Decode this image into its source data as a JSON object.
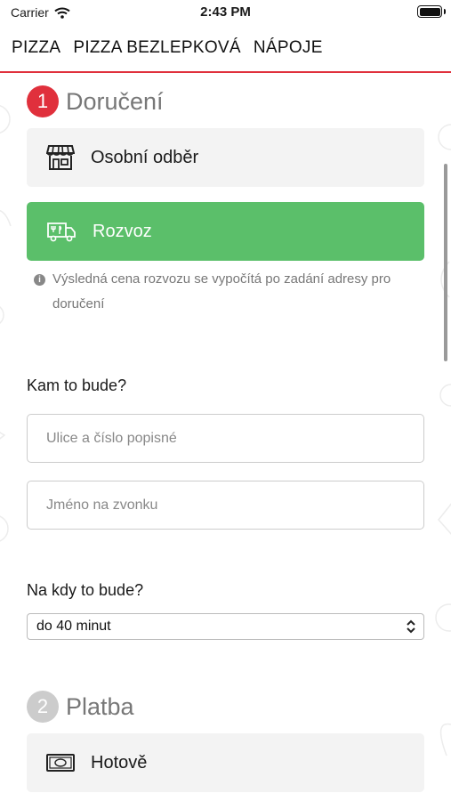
{
  "status_bar": {
    "carrier": "Carrier",
    "time": "2:43 PM"
  },
  "nav": {
    "items": [
      "PIZZA",
      "PIZZA BEZLEPKOVÁ",
      "NÁPOJE"
    ]
  },
  "delivery": {
    "step_number": "1",
    "title": "Doručení",
    "options": [
      {
        "label": "Osobní odběr",
        "icon": "store-icon",
        "selected": false
      },
      {
        "label": "Rozvoz",
        "icon": "delivery-van-icon",
        "selected": true
      }
    ],
    "info_text": "Výsledná cena rozvozu se vypočítá po zadání adresy pro doručení"
  },
  "address": {
    "label": "Kam to bude?",
    "street_placeholder": "Ulice a číslo popisné",
    "bell_placeholder": "Jméno na zvonku"
  },
  "time": {
    "label": "Na kdy to bude?",
    "selected": "do 40 minut"
  },
  "payment": {
    "step_number": "2",
    "title": "Platba",
    "options": [
      {
        "label": "Hotově",
        "icon": "cash-icon"
      }
    ]
  },
  "colors": {
    "accent_red": "#e0303c",
    "selected_green": "#5bbf6a",
    "step_inactive": "#cccccc"
  }
}
